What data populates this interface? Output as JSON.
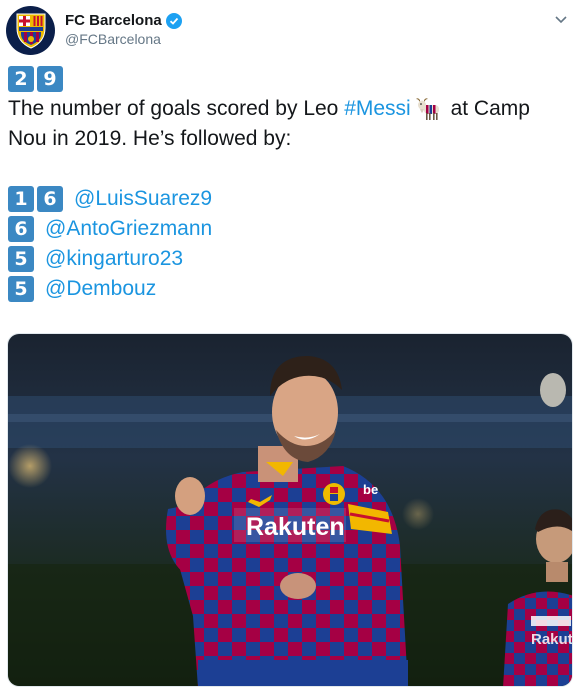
{
  "account": {
    "display_name": "FC Barcelona",
    "handle": "@FCBarcelona",
    "avatar_icon": "fc-barcelona-crest-icon",
    "verified_icon": "verified-badge-icon"
  },
  "tweet": {
    "count_digits": [
      "2",
      "9"
    ],
    "text_part1": "The number of goals scored by Leo ",
    "hashtag": "#Messi",
    "emoji": "goat-emoji",
    "text_part2": " at Camp",
    "text_line2": "Nou in 2019. He’s followed by:",
    "rankings": [
      {
        "digits": [
          "1",
          "6"
        ],
        "mention": "@LuisSuarez9"
      },
      {
        "digits": [
          "6"
        ],
        "mention": "@AntoGriezmann"
      },
      {
        "digits": [
          "5"
        ],
        "mention": "@kingarturo23"
      },
      {
        "digits": [
          "5"
        ],
        "mention": "@Dembouz"
      }
    ]
  },
  "media": {
    "sponsor_text": "Rakuten"
  },
  "colors": {
    "link": "#1b95e0",
    "keycap": "#3b88c3",
    "verified": "#1da1f2",
    "kit_blue": "#1c3f94",
    "kit_red": "#a50044"
  }
}
